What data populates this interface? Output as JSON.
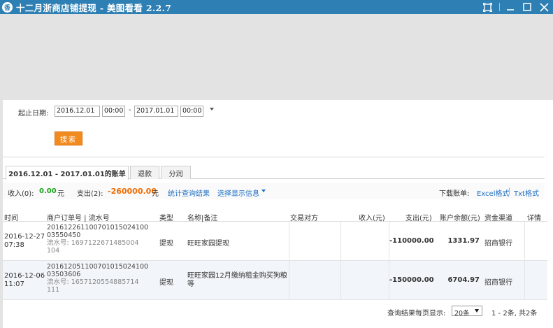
{
  "window": {
    "icon_text": "香",
    "title": "十二月浙商店铺提现 - 美图看看 2.2.7"
  },
  "filter": {
    "label": "起止日期:",
    "start_date": "2016.12.01",
    "start_time": "00:00",
    "separator": "-",
    "end_date": "2017.01.01",
    "end_time": "00:00",
    "search_label": "搜索"
  },
  "tabs": [
    {
      "label": "2016.12.01 - 2017.01.01的账单"
    },
    {
      "label": "退款"
    },
    {
      "label": "分润"
    }
  ],
  "summary": {
    "income_label": "收入(0):",
    "income_value": "0.00",
    "income_unit": "元",
    "expense_label": "支出(2):",
    "expense_value": "-260000.00",
    "expense_unit": "元",
    "stats_link": "统计查询结果",
    "display_link": "选择显示信息",
    "download_label": "下载账单:",
    "excel_link": "Excel格式",
    "link_sep": "|",
    "txt_link": "Txt格式"
  },
  "table": {
    "columns": [
      "时间",
      "商户订单号 | 流水号",
      "类型",
      "名称|备注",
      "交易对方",
      "收入(元)",
      "支出(元)",
      "账户余额(元)",
      "资金渠道",
      "详情"
    ],
    "rows": [
      {
        "date": "2016-12-27",
        "time": "07:38",
        "order_line1": "201612261100701015024100",
        "order_line2": "03550450",
        "serial_line1": "流水号: 1697122671485004",
        "serial_line2": "104",
        "type": "提现",
        "name": "旺旺家园提现",
        "counterparty": "",
        "income": "",
        "expense": "-110000.00",
        "balance": "1331.97",
        "channel": "招商银行"
      },
      {
        "date": "2016-12-06",
        "time": "11:07",
        "order_line1": "201612051100701015024100",
        "order_line2": "03503606",
        "serial_line1": "流水号: 1657120554885714",
        "serial_line2": "111",
        "type": "提现",
        "name": "旺旺家园12月缴纳租金购买狗粮等",
        "counterparty": "",
        "income": "",
        "expense": "-150000.00",
        "balance": "6704.97",
        "channel": "招商银行"
      }
    ]
  },
  "pager": {
    "per_page_label": "查询结果每页显示:",
    "per_page_value": "20条",
    "range_text": "1 - 2条, 共2条"
  }
}
